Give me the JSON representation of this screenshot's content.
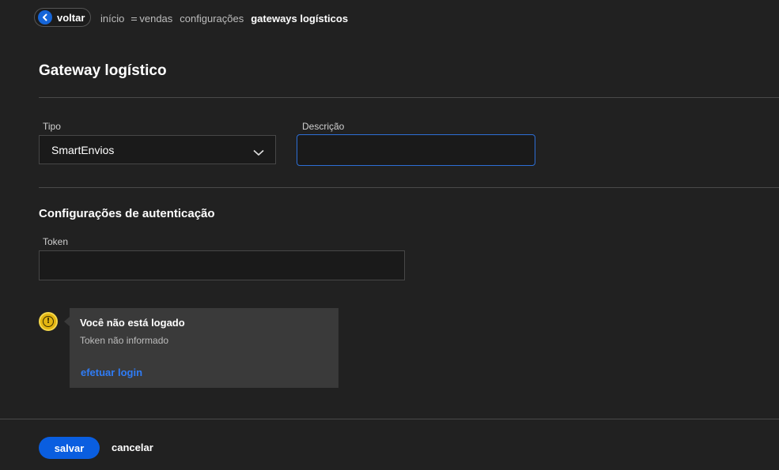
{
  "breadcrumb": {
    "back_label": "voltar",
    "items": [
      "início",
      "vendas",
      "configurações",
      "gateways logísticos"
    ]
  },
  "page": {
    "title": "Gateway logístico"
  },
  "form": {
    "tipo_label": "Tipo",
    "tipo_value": "SmartEnvios",
    "descricao_label": "Descrição",
    "descricao_value": "",
    "auth_section_title": "Configurações de autenticação",
    "token_label": "Token",
    "token_value": ""
  },
  "notice": {
    "icon": "info-warning-icon",
    "title": "Você não está logado",
    "subtitle": "Token não informado",
    "link": "efetuar login",
    "color": "#e3b511"
  },
  "actions": {
    "save": "salvar",
    "cancel": "cancelar"
  },
  "colors": {
    "accent": "#0a5ee0",
    "background": "#212121",
    "link": "#2f7cf6"
  }
}
